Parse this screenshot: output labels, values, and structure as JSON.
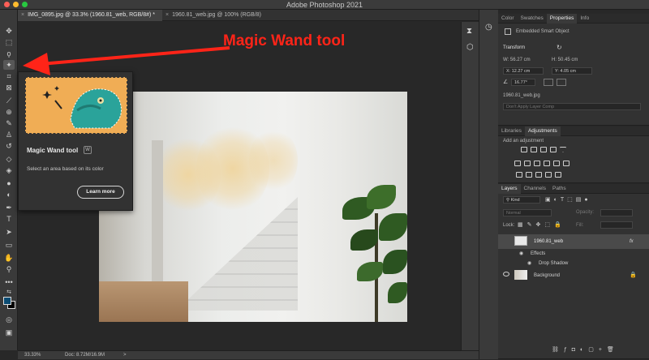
{
  "app": {
    "title": "Adobe Photoshop 2021",
    "window_controls": {
      "close": "#ff5f57",
      "minimize": "#febc2e",
      "zoom": "#28c840"
    }
  },
  "tabs": [
    {
      "label": "IMG_0895.jpg @ 33.3% (1960.81_web, RGB/8#) *",
      "close": "×",
      "active": true
    },
    {
      "label": "1960.81_web.jpg @ 100% (RGB/8)",
      "close": "×",
      "active": false
    }
  ],
  "toolbar": {
    "tools": [
      "move-icon",
      "marquee-icon",
      "lasso-icon",
      "magic-wand-icon",
      "crop-icon",
      "frame-icon",
      "eyedropper-icon",
      "spot-healing-icon",
      "brush-icon",
      "clone-stamp-icon",
      "history-brush-icon",
      "eraser-icon",
      "paint-bucket-icon",
      "blur-icon",
      "dodge-icon",
      "pen-icon",
      "type-icon",
      "path-selection-icon",
      "rectangle-icon",
      "hand-icon",
      "zoom-icon",
      "more-icon"
    ],
    "selected": "magic-wand-icon",
    "foreground_color": "#0b4c73",
    "background_color": "#000000"
  },
  "tooltip": {
    "title": "Magic Wand tool",
    "shortcut": "W",
    "description": "Select an area based on its color",
    "button": "Learn more"
  },
  "annotation": {
    "text": "Magic Wand tool",
    "color": "#ff2418"
  },
  "status": {
    "zoom": "33.33%",
    "doc": "Doc: 8.72M/16.9M",
    "arrow": ">"
  },
  "properties_panel": {
    "tabs": [
      "Color",
      "Swatches",
      "Properties",
      "Info"
    ],
    "active_tab": "Properties",
    "object_type": "Embedded Smart Object",
    "section": "Transform",
    "w": "W: 56.27 cm",
    "h": "H: 50.45 cm",
    "x": "X: 12.27 cm",
    "y": "Y: 4.05 cm",
    "angle": "16.77°",
    "filename": "1960.81_web.jpg",
    "comp_placeholder": "Don't Apply Layer Comp"
  },
  "adjustments_panel": {
    "tabs": [
      "Libraries",
      "Adjustments"
    ],
    "active_tab": "Adjustments",
    "heading": "Add an adjustment"
  },
  "layers_panel": {
    "tabs": [
      "Layers",
      "Channels",
      "Paths"
    ],
    "active_tab": "Layers",
    "filter": "Kind",
    "blend_mode": "Normal",
    "opacity_label": "Opacity:",
    "lock_label": "Lock:",
    "fill_label": "Fill:",
    "layers": [
      {
        "name": "1960.81_web",
        "fx": "fx",
        "selected": true
      },
      {
        "name": "Effects",
        "sub": true
      },
      {
        "name": "Drop Shadow",
        "sub": true
      },
      {
        "name": "Background",
        "locked": true
      }
    ]
  }
}
